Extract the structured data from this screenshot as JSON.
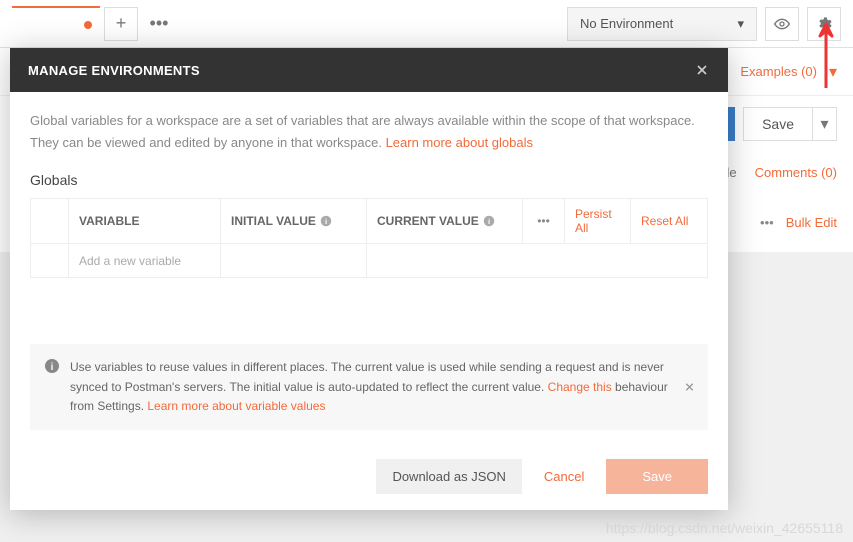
{
  "topbar": {
    "env_label": "No Environment",
    "add_tab": "+",
    "more": "•••"
  },
  "row2": {
    "examples": "Examples (0)"
  },
  "row3": {
    "save": "Save"
  },
  "row4": {
    "de": "de",
    "comments": "Comments (0)"
  },
  "row5": {
    "dots": "•••",
    "bulk": "Bulk Edit"
  },
  "modal": {
    "title": "MANAGE ENVIRONMENTS",
    "desc1": "Global variables for a workspace are a set of variables that are always available within the scope of that workspace. They can be viewed and edited by anyone in that workspace. ",
    "learn_globals": "Learn more about globals",
    "section": "Globals",
    "headers": {
      "variable": "VARIABLE",
      "initial": "INITIAL VALUE",
      "current": "CURRENT VALUE",
      "dots": "•••",
      "persist": "Persist All",
      "reset": "Reset All"
    },
    "placeholder": "Add a new variable",
    "banner1": "Use variables to reuse values in different places. The current value is used while sending a request and is never synced to Postman's servers. The initial value is auto-updated to reflect the current value. ",
    "banner_change": "Change this",
    "banner2": " behaviour from Settings. ",
    "banner_learn": "Learn more about variable values",
    "footer": {
      "download": "Download as JSON",
      "cancel": "Cancel",
      "save": "Save"
    }
  },
  "watermark": "https://blog.csdn.net/weixin_42655118"
}
